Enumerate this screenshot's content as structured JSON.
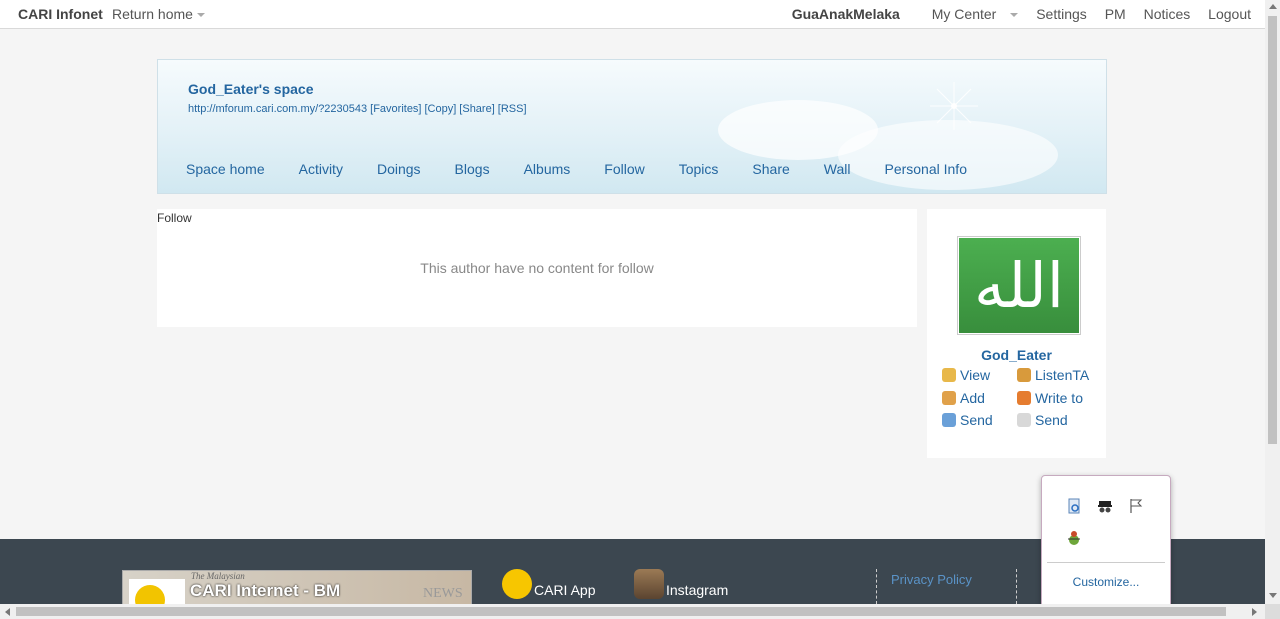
{
  "topbar": {
    "brand": "CARI Infonet",
    "return_home": "Return home",
    "username": "GuaAnakMelaka",
    "my_center": "My Center",
    "settings": "Settings",
    "pm": "PM",
    "notices": "Notices",
    "logout": "Logout"
  },
  "banner": {
    "space_title": "God_Eater's space",
    "space_url": "http://mforum.cari.com.my/?2230543",
    "favorites": "[Favorites]",
    "copy": "[Copy]",
    "share": "[Share]",
    "rss": "[RSS]"
  },
  "nav": [
    "Space home",
    "Activity",
    "Doings",
    "Blogs",
    "Albums",
    "Follow",
    "Topics",
    "Share",
    "Wall",
    "Personal Info"
  ],
  "main": {
    "section_label": "Follow",
    "empty_message": "This author have no content for follow"
  },
  "sidebar": {
    "avatar_glyph": "الله",
    "username": "God_Eater",
    "actions": [
      {
        "label": "View",
        "icon": "megaphone-icon"
      },
      {
        "label": "ListenTA",
        "icon": "user-listen-icon"
      },
      {
        "label": "Add",
        "icon": "handshake-icon"
      },
      {
        "label": "Write to",
        "icon": "pencil-icon"
      },
      {
        "label": "Send",
        "icon": "chat-user-icon"
      },
      {
        "label": "Send",
        "icon": "envelope-icon"
      }
    ]
  },
  "footer": {
    "promo_top": "The Malaysian",
    "promo_text": "CARI Internet - BM",
    "promo_news": "NEWS",
    "cari_app": "CARI App",
    "instagram": "Instagram",
    "privacy_policy": "Privacy Policy"
  },
  "popup": {
    "customize": "Customize..."
  },
  "colors": {
    "link": "#2466a0",
    "footer_bg": "#3c4750",
    "banner_sky": "#d1e8f1"
  }
}
